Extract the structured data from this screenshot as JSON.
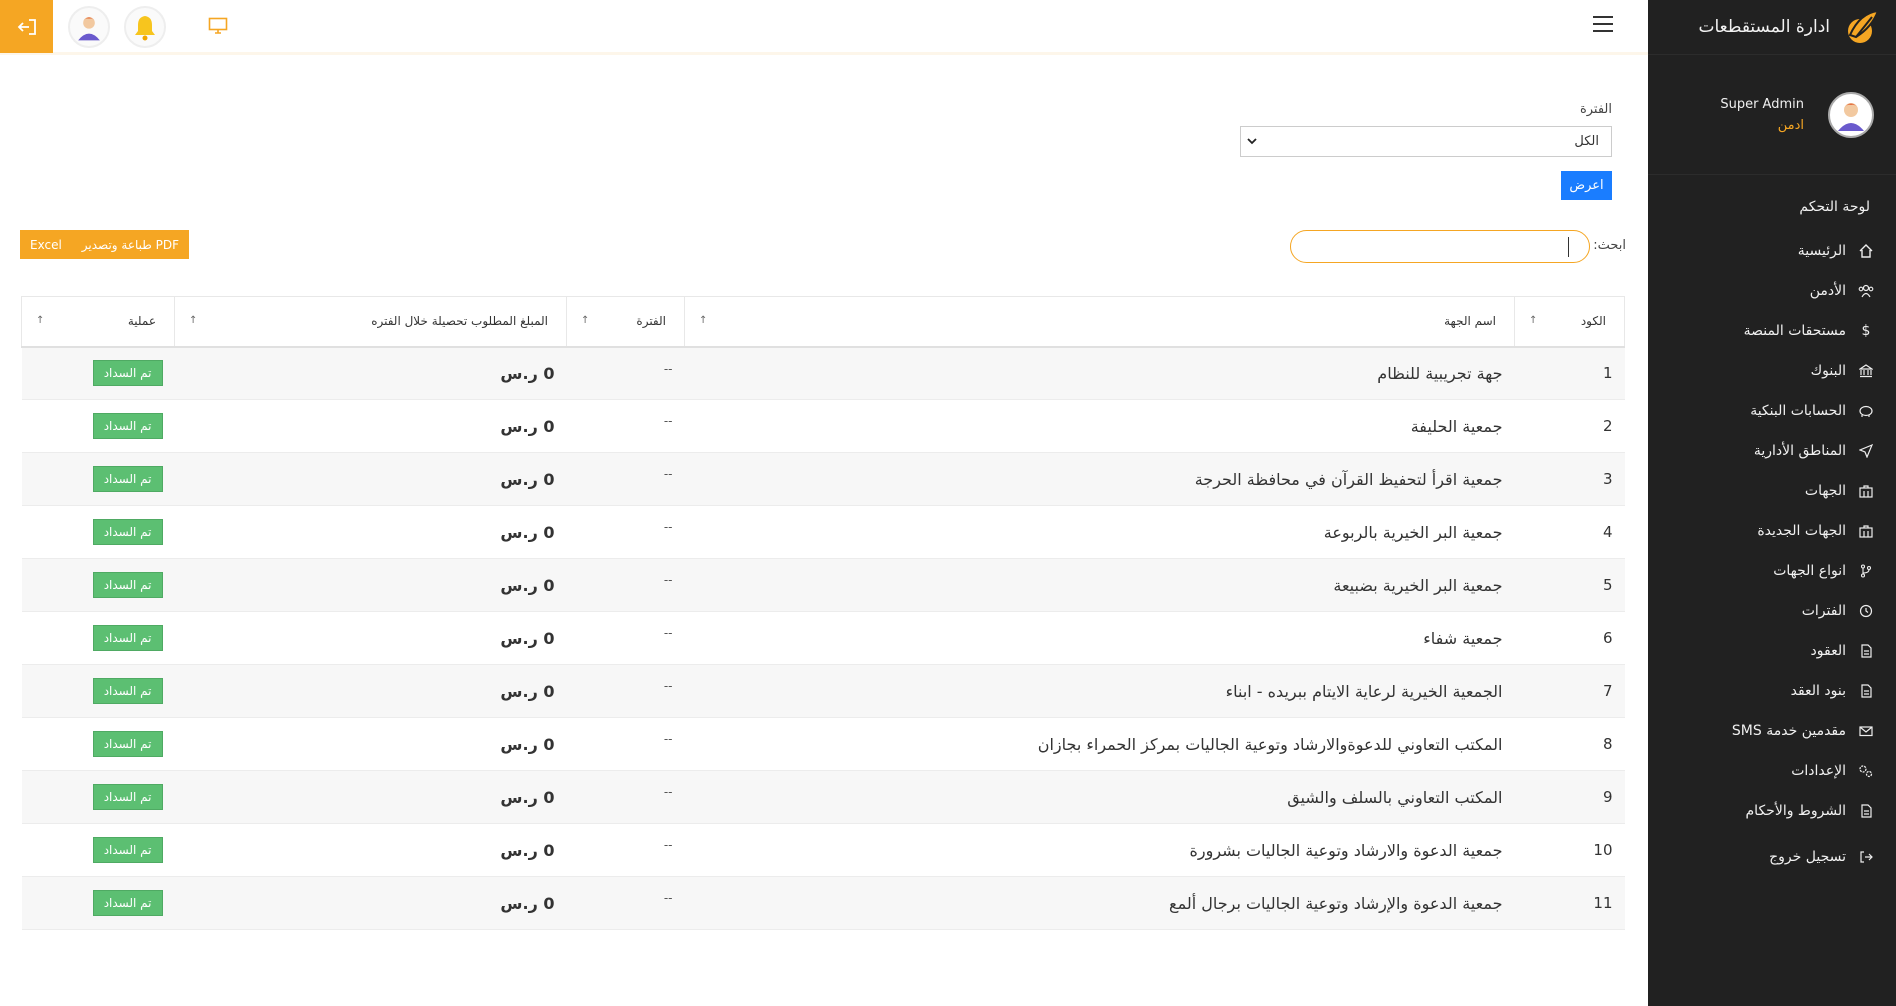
{
  "app": {
    "brand_name": "ادارة المستقطعات"
  },
  "profile": {
    "name": "Super Admin",
    "role": "ادمن"
  },
  "sidebar": {
    "section_title": "لوحة التحكم",
    "items": [
      {
        "label": "الرئيسية",
        "icon": "home-icon"
      },
      {
        "label": "الأدمن",
        "icon": "users-icon"
      },
      {
        "label": "مستحقات المنصة",
        "icon": "dollar-icon"
      },
      {
        "label": "البنوك",
        "icon": "bank-icon"
      },
      {
        "label": "الحسابات البنكية",
        "icon": "piggy-bank-icon"
      },
      {
        "label": "المناطق الأدارية",
        "icon": "send-icon"
      },
      {
        "label": "الجهات",
        "icon": "building-icon"
      },
      {
        "label": "الجهات الجديدة",
        "icon": "building-icon"
      },
      {
        "label": "انواع الجهات",
        "icon": "branch-icon"
      },
      {
        "label": "الفترات",
        "icon": "clock-icon"
      },
      {
        "label": "العقود",
        "icon": "document-icon"
      },
      {
        "label": "بنود العقد",
        "icon": "document-icon"
      },
      {
        "label": "مقدمين خدمة SMS",
        "icon": "mail-icon"
      },
      {
        "label": "الإعدادات",
        "icon": "gears-icon"
      },
      {
        "label": "الشروط والأحكام",
        "icon": "document-icon"
      }
    ],
    "logout": {
      "label": "تسجيل خروج",
      "icon": "logout-icon"
    }
  },
  "filter": {
    "label": "الفترة",
    "selected": "الكل",
    "show_button": "اعرض"
  },
  "export": {
    "print_pdf": "طباعة وتصدير PDF",
    "excel": "Excel"
  },
  "search": {
    "label": "ابحث:",
    "value": ""
  },
  "table": {
    "headers": {
      "code": "الكود",
      "name": "اسم الجهة",
      "period": "الفترة",
      "amount": "المبلغ المطلوب تحصيلة خلال الفتره",
      "action": "عملية"
    },
    "rows": [
      {
        "code": "1",
        "name": "جهة تجريبية للنظام",
        "period": "--",
        "amount": "0 ر.س",
        "action": "تم السداد"
      },
      {
        "code": "2",
        "name": "جمعية الحليفة",
        "period": "--",
        "amount": "0 ر.س",
        "action": "تم السداد"
      },
      {
        "code": "3",
        "name": "جمعية اقرأ لتحفيظ القرآن في محافظة الحرجة",
        "period": "--",
        "amount": "0 ر.س",
        "action": "تم السداد"
      },
      {
        "code": "4",
        "name": "جمعية البر الخيرية بالربوعة",
        "period": "--",
        "amount": "0 ر.س",
        "action": "تم السداد"
      },
      {
        "code": "5",
        "name": "جمعية البر الخيرية بضبيعة",
        "period": "--",
        "amount": "0 ر.س",
        "action": "تم السداد"
      },
      {
        "code": "6",
        "name": "جمعية شفاء",
        "period": "--",
        "amount": "0 ر.س",
        "action": "تم السداد"
      },
      {
        "code": "7",
        "name": "الجمعية الخيرية لرعاية الايتام ببريده - ابناء",
        "period": "--",
        "amount": "0 ر.س",
        "action": "تم السداد"
      },
      {
        "code": "8",
        "name": "المكتب التعاوني للدعوةوالارشاد وتوعية الجاليات بمركز الحمراء بجازان",
        "period": "--",
        "amount": "0 ر.س",
        "action": "تم السداد"
      },
      {
        "code": "9",
        "name": "المكتب التعاوني بالسلف والشيق",
        "period": "--",
        "amount": "0 ر.س",
        "action": "تم السداد"
      },
      {
        "code": "10",
        "name": "جمعية الدعوة والارشاد وتوعية الجاليات بشرورة",
        "period": "--",
        "amount": "0 ر.س",
        "action": "تم السداد"
      },
      {
        "code": "11",
        "name": "جمعية الدعوة والإرشاد وتوعية الجاليات برجال ألمع",
        "period": "--",
        "amount": "0 ر.س",
        "action": "تم السداد"
      }
    ]
  },
  "colors": {
    "accent": "#f5a623",
    "sidebar_bg": "#212121",
    "primary_button": "#1a7dff",
    "paid_button": "#5cbf72"
  }
}
